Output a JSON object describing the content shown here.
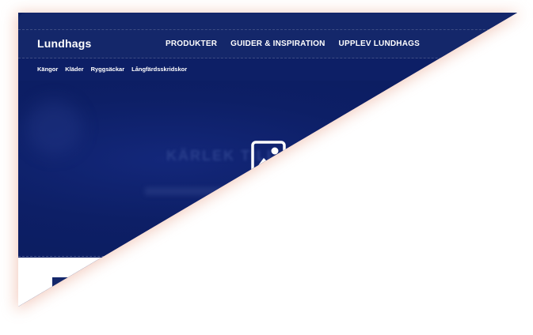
{
  "brand": {
    "name": "Lundhags"
  },
  "main_nav": {
    "items": [
      {
        "label": "PRODUKTER"
      },
      {
        "label": "GUIDER & INSPIRATION"
      },
      {
        "label": "UPPLEV LUNDHAGS"
      }
    ]
  },
  "sub_nav": {
    "items": [
      {
        "label": "Kängor"
      },
      {
        "label": "Kläder"
      },
      {
        "label": "Ryggsäckar"
      },
      {
        "label": "Långfärdsskridskor"
      }
    ]
  },
  "hero": {
    "blurred_text": "KÄRLEK TILL",
    "image_icon": "image-placeholder-icon"
  },
  "colors": {
    "brand_navy": "#0d1f66",
    "header_navy": "#14276a",
    "shadow": "#e9a48d"
  }
}
